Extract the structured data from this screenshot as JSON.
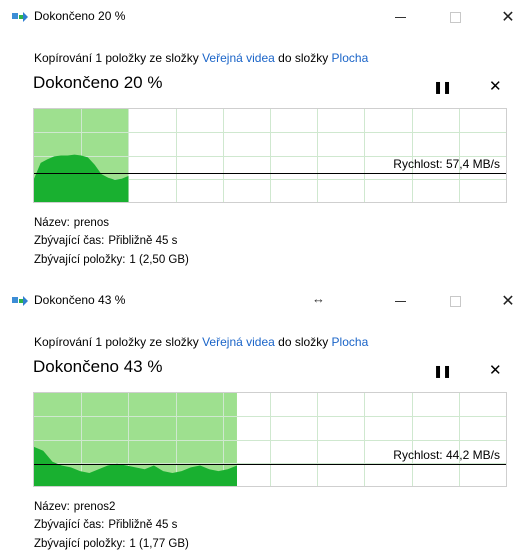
{
  "dialogs": [
    {
      "window_title": "Dokončeno 20 %",
      "desc_prefix": "Kopírování 1 položky ze složky",
      "source_folder": "Veřejná videa",
      "desc_mid": "do složky",
      "dest_folder": "Plocha",
      "progress_title": "Dokončeno 20 %",
      "progress": 0.2,
      "speed_label": "Rychlost: 57,4 MB/s",
      "speed_level": 0.31,
      "name_label": "Název:",
      "name_value": "prenos",
      "time_label": "Zbývající čas:",
      "time_value": "Přibližně 45 s",
      "items_label": "Zbývající položky:",
      "items_value": "1 (2,50 GB)",
      "throughput": [
        0.25,
        0.42,
        0.46,
        0.49,
        0.5,
        0.5,
        0.51,
        0.5,
        0.48,
        0.4,
        0.3,
        0.26,
        0.24,
        0.25,
        0.28
      ]
    },
    {
      "window_title": "Dokončeno 43 %",
      "desc_prefix": "Kopírování 1 položky ze složky",
      "source_folder": "Veřejná videa",
      "desc_mid": "do složky",
      "dest_folder": "Plocha",
      "progress_title": "Dokončeno 43 %",
      "progress": 0.43,
      "speed_label": "Rychlost: 44,2 MB/s",
      "speed_level": 0.24,
      "name_label": "Název:",
      "name_value": "prenos2",
      "time_label": "Zbývající čas:",
      "time_value": "Přibližně 45 s",
      "items_label": "Zbývající položky:",
      "items_value": "1 (1,77 GB)",
      "throughput": [
        0.42,
        0.38,
        0.26,
        0.22,
        0.2,
        0.16,
        0.14,
        0.18,
        0.22,
        0.24,
        0.22,
        0.2,
        0.18,
        0.22,
        0.16,
        0.14,
        0.16,
        0.2,
        0.22,
        0.18,
        0.16,
        0.18,
        0.22
      ]
    }
  ],
  "icons": {
    "app": "copy-files-icon",
    "move": "move-cursor-icon",
    "minimize": "minimize-icon",
    "maximize": "maximize-icon",
    "close": "close-icon",
    "pause": "pause-icon",
    "cancel": "cancel-icon"
  },
  "glyphs": {
    "close": "✕",
    "pause": "❚❚",
    "cancel": "✕",
    "move": "↔"
  },
  "colors": {
    "progress_fill": "#9ee08f",
    "throughput_fill": "#19b030",
    "grid_line": "#cfe8cf",
    "link": "#1a64c8"
  }
}
